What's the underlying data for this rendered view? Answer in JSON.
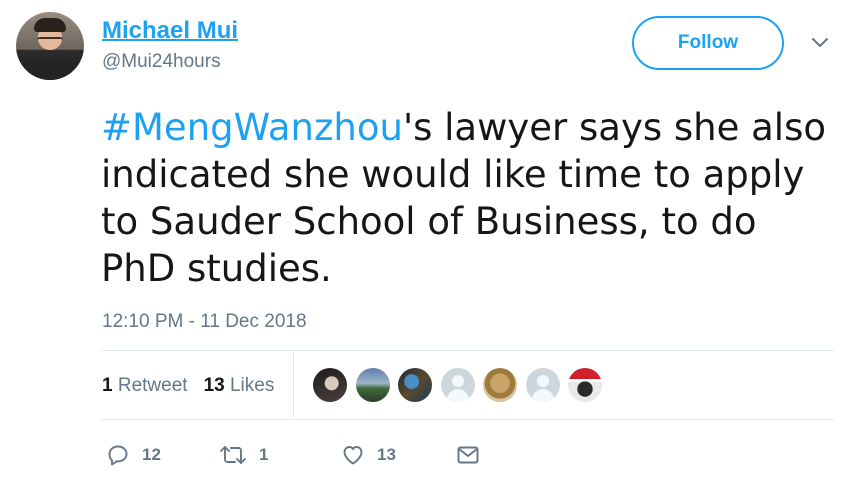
{
  "author": {
    "name": "Michael Mui",
    "handle": "@Mui24hours"
  },
  "follow_button": {
    "label": "Follow"
  },
  "tweet": {
    "hashtag": "#MengWanzhou",
    "text_after_hashtag": "'s lawyer says she also indicated she would like time to apply to Sauder School of Business, to do PhD studies.",
    "timestamp": "12:10 PM - 11 Dec 2018"
  },
  "stats": {
    "retweets_count": "1",
    "retweets_label": "Retweet",
    "likes_count": "13",
    "likes_label": "Likes"
  },
  "liked_by_avatars": 7,
  "actions": {
    "reply_count": "12",
    "retweet_count": "1",
    "like_count": "13"
  },
  "colors": {
    "accent": "#1da1f2",
    "secondary_text": "#657786",
    "primary_text": "#14171a",
    "divider": "#e1e8ed"
  },
  "icons": [
    "reply-icon",
    "retweet-icon",
    "heart-icon",
    "direct-message-icon",
    "caret-down-icon"
  ]
}
